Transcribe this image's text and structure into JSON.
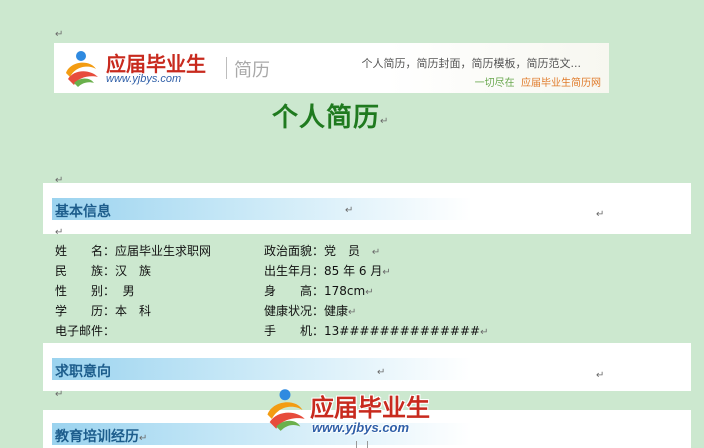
{
  "banner": {
    "logo_text": "应届毕业生",
    "logo_url": "www.yjbys.com",
    "section_word": "简历",
    "slogan": "个人简历，简历封面，简历模板，简历范文...",
    "tagline_prefix": "一切尽在",
    "tagline_site": "应届毕业生简历网"
  },
  "document": {
    "title": "个人简历",
    "paragraph_mark": "↵"
  },
  "sections": {
    "basic_info": "基本信息",
    "job_intention": "求职意向",
    "education": "教育培训经历"
  },
  "basic_info": {
    "name_label": "姓　　名：",
    "name_value": "应届毕业生求职网",
    "politics_label": "政治面貌：",
    "politics_value": "党　员",
    "ethnic_label": "民　　族：",
    "ethnic_value": "汉　族",
    "birth_label": "出生年月：",
    "birth_value": "85 年 6 月",
    "gender_label": "性　　别：",
    "gender_value": "男",
    "height_label": "身　　高：",
    "height_value": "178cm",
    "degree_label": "学　　历：",
    "degree_value": "本　科",
    "health_label": "健康状况：",
    "health_value": "健康",
    "email_label": "电子邮件：",
    "email_value": "",
    "phone_label": "手　　机：",
    "phone_value": "13##############"
  },
  "watermark": {
    "logo_text": "应届毕业生",
    "logo_url": "www.yjbys.com"
  },
  "colors": {
    "page_bg": "#cce8cf",
    "title_green": "#1f7a1f",
    "section_text": "#1d5d8c",
    "brand_red": "#c82a1e",
    "brand_blue": "#2f5fa8"
  }
}
